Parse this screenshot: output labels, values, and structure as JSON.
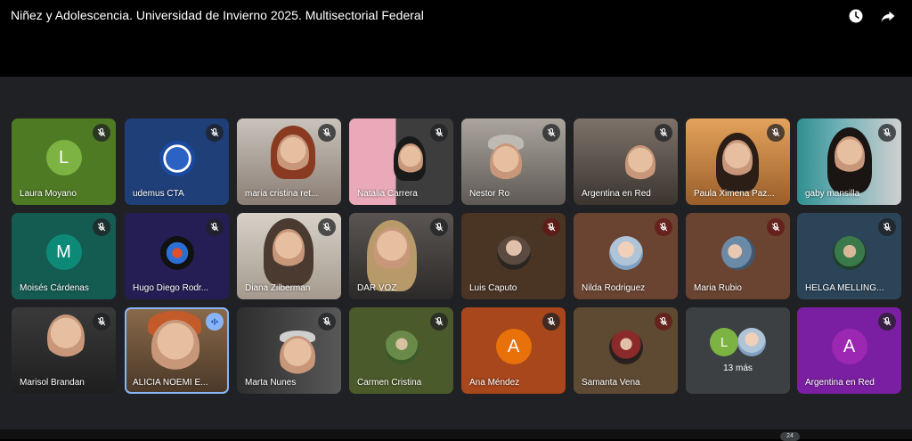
{
  "window": {
    "title": "Niñez y Adolescencia. Universidad de Invierno 2025. Multisectorial Federal",
    "watch_later_icon": "clock-icon",
    "share_icon": "share-arrow-icon"
  },
  "colors": {
    "page_bg": "#000000",
    "stage_bg": "#202124",
    "active_outline": "#8ab4f8"
  },
  "participants": [
    {
      "name": "Laura Moyano",
      "avatar_letter": "L",
      "mic": "muted"
    },
    {
      "name": "udemus CTA",
      "mic": "muted"
    },
    {
      "name": "maria cristina ret...",
      "mic": "muted"
    },
    {
      "name": "Natalia Carrera",
      "mic": "muted"
    },
    {
      "name": "Nestor Ro",
      "mic": "muted"
    },
    {
      "name": "Argentina en Red",
      "mic": "muted"
    },
    {
      "name": "Paula Ximena Paz...",
      "mic": "muted"
    },
    {
      "name": "gaby mansilla",
      "mic": "muted"
    },
    {
      "name": "Moisés Cárdenas",
      "avatar_letter": "M",
      "mic": "muted"
    },
    {
      "name": "Hugo Diego Rodr...",
      "mic": "muted"
    },
    {
      "name": "Diana Zilberman",
      "mic": "muted"
    },
    {
      "name": "DAR VOZ",
      "mic": "muted"
    },
    {
      "name": "Luis Caputo",
      "mic": "muted"
    },
    {
      "name": "Nilda Rodriguez",
      "mic": "muted"
    },
    {
      "name": "Maria Rubio",
      "mic": "muted"
    },
    {
      "name": "HELGA MELLING...",
      "mic": "muted"
    },
    {
      "name": "Marisol Brandan",
      "mic": "muted"
    },
    {
      "name": "ALICIA NOEMI E...",
      "mic": "speaking"
    },
    {
      "name": "Marta Nunes",
      "mic": "muted"
    },
    {
      "name": "Carmen Cristina",
      "mic": "muted"
    },
    {
      "name": "Ana Méndez",
      "avatar_letter": "A",
      "mic": "muted"
    },
    {
      "name": "Samanta Vena",
      "mic": "muted"
    },
    {
      "more_label": "13 más",
      "avatar_letter": "L"
    },
    {
      "name": "Argentina en Red",
      "avatar_letter": "A",
      "mic": "muted"
    }
  ],
  "bottom": {
    "badge": "24"
  }
}
